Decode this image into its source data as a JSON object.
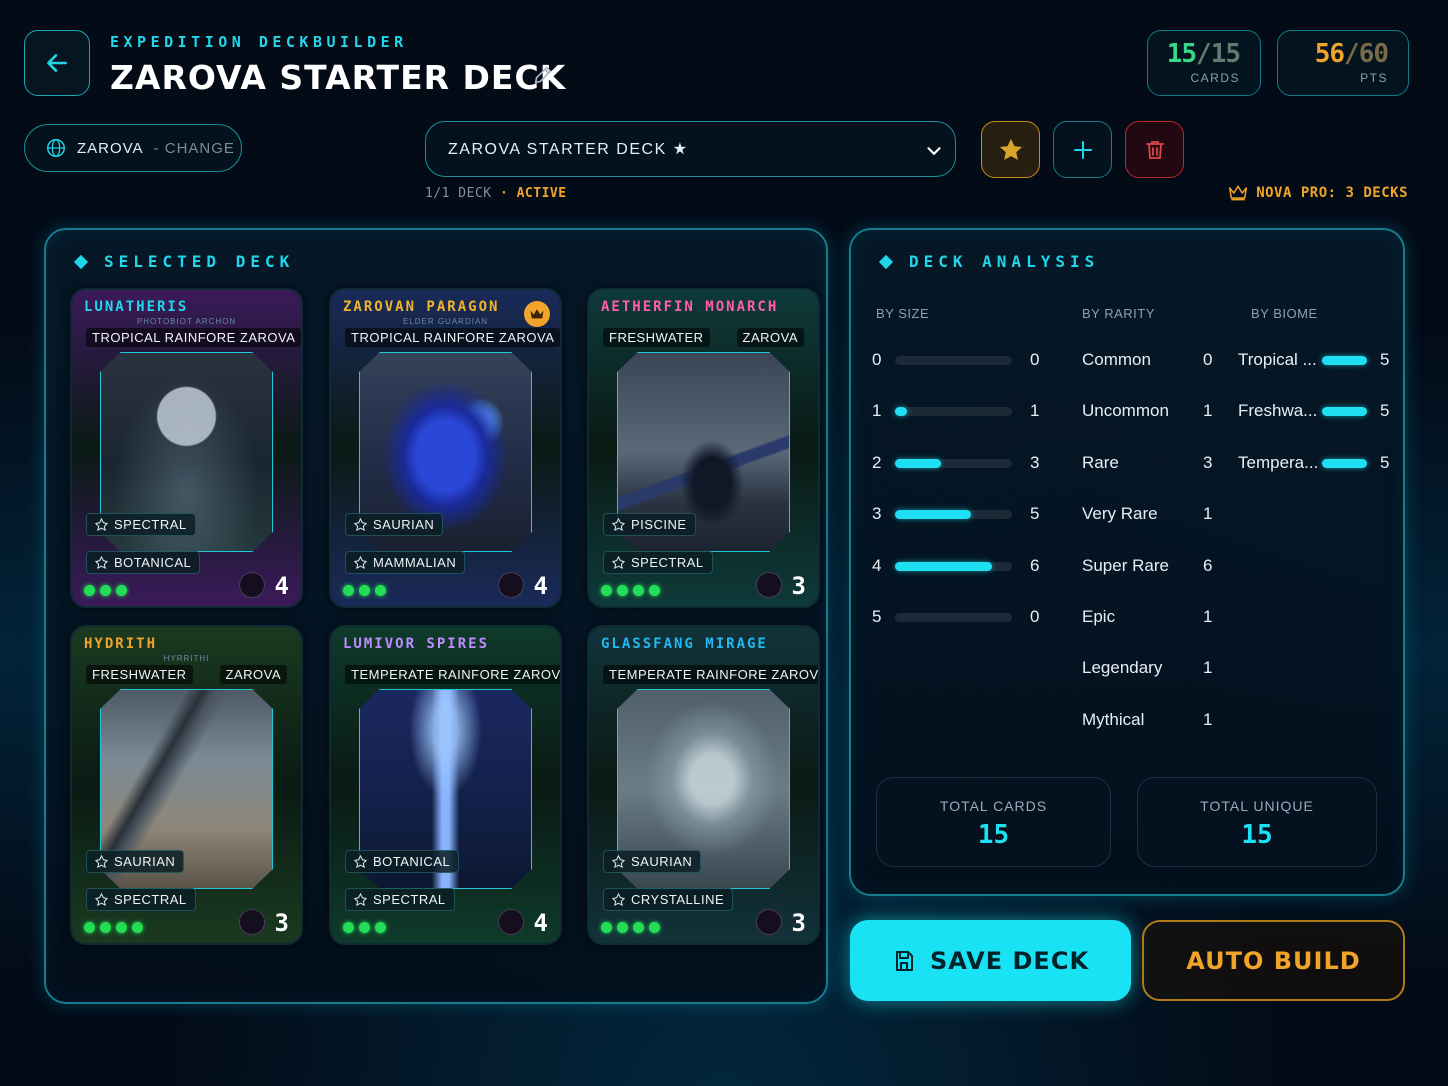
{
  "header": {
    "eyebrow": "EXPEDITION DECKBUILDER",
    "title": "ZAROVA STARTER DECK",
    "cards_stat": {
      "current": "15",
      "sep": "/",
      "max": "15",
      "label": "CARDS"
    },
    "points_stat": {
      "current": "56",
      "sep": "/",
      "max": "60",
      "label": "PTS"
    }
  },
  "realm": {
    "name": "ZAROVA",
    "action": "- CHANGE"
  },
  "deck_select": {
    "selected": "ZAROVA STARTER DECK ★"
  },
  "deck_meta": {
    "count": "1/1 DECK",
    "sep": "·",
    "status": "ACTIVE"
  },
  "pro_notice": "NOVA PRO: 3 DECKS",
  "selected_deck": {
    "heading": "SELECTED DECK",
    "cards": [
      {
        "name": "LUNATHERIS",
        "subtitle": "PHOTOBIOT ARCHON",
        "biome": "TROPICAL RAINFORE ZAROVA",
        "region": "",
        "tags": [
          "SPECTRAL",
          "BOTANICAL"
        ],
        "rarity_dots": 3,
        "cost": "4",
        "name_color": "#23d6ea",
        "art": "moon"
      },
      {
        "name": "ZAROVAN PARAGON",
        "subtitle": "ELDER GUARDIAN",
        "biome": "TROPICAL RAINFORE ZAROVA",
        "region": "",
        "tags": [
          "SAURIAN",
          "MAMMALIAN"
        ],
        "rarity_dots": 3,
        "cost": "4",
        "name_color": "#f0b429",
        "art": "beast",
        "crowned": true
      },
      {
        "name": "AETHERFIN MONARCH",
        "subtitle": "",
        "biome": "FRESHWATER",
        "region": "ZAROVA",
        "tags": [
          "PISCINE",
          "SPECTRAL"
        ],
        "rarity_dots": 4,
        "cost": "3",
        "name_color": "#ff5fa8",
        "art": "fin"
      },
      {
        "name": "HYDRITH",
        "subtitle": "HYRRITHI",
        "biome": "FRESHWATER",
        "region": "ZAROVA",
        "tags": [
          "SAURIAN",
          "SPECTRAL"
        ],
        "rarity_dots": 4,
        "cost": "3",
        "name_color": "#f0a52a",
        "art": "river"
      },
      {
        "name": "LUMIVOR SPIRES",
        "subtitle": "",
        "biome": "TEMPERATE RAINFORE ZAROVA",
        "region": "",
        "tags": [
          "BOTANICAL",
          "SPECTRAL"
        ],
        "rarity_dots": 3,
        "cost": "4",
        "name_color": "#c08cff",
        "art": "tree"
      },
      {
        "name": "GLASSFANG MIRAGE",
        "subtitle": "",
        "biome": "TEMPERATE RAINFORE ZAROVA",
        "region": "",
        "tags": [
          "SAURIAN",
          "CRYSTALLINE"
        ],
        "rarity_dots": 4,
        "cost": "3",
        "name_color": "#23b8f0",
        "art": "glass"
      }
    ]
  },
  "analysis": {
    "heading": "DECK ANALYSIS",
    "by_size_label": "BY SIZE",
    "by_rarity_label": "BY RARITY",
    "by_biome_label": "BY BIOME",
    "by_size": [
      {
        "size": "0",
        "count": "0",
        "fill": 0
      },
      {
        "size": "1",
        "count": "1",
        "fill": 0.1
      },
      {
        "size": "2",
        "count": "3",
        "fill": 0.39
      },
      {
        "size": "3",
        "count": "5",
        "fill": 0.65
      },
      {
        "size": "4",
        "count": "6",
        "fill": 0.83
      },
      {
        "size": "5",
        "count": "0",
        "fill": 0
      }
    ],
    "by_rarity": [
      {
        "name": "Common",
        "count": "0"
      },
      {
        "name": "Uncommon",
        "count": "1"
      },
      {
        "name": "Rare",
        "count": "3"
      },
      {
        "name": "Very Rare",
        "count": "1"
      },
      {
        "name": "Super Rare",
        "count": "6"
      },
      {
        "name": "Epic",
        "count": "1"
      },
      {
        "name": "Legendary",
        "count": "1"
      },
      {
        "name": "Mythical",
        "count": "1"
      }
    ],
    "by_biome": [
      {
        "name": "Tropical ...",
        "count": "5",
        "fill": 1
      },
      {
        "name": "Freshwa...",
        "count": "5",
        "fill": 1
      },
      {
        "name": "Tempera...",
        "count": "5",
        "fill": 1
      }
    ],
    "total_cards_label": "TOTAL CARDS",
    "total_cards": "15",
    "total_unique_label": "TOTAL UNIQUE",
    "total_unique": "15"
  },
  "actions": {
    "save": "SAVE DECK",
    "auto_build": "AUTO BUILD"
  },
  "colors": {
    "accent": "#1ee0f2",
    "gold": "#f0a52a",
    "danger": "#d03434",
    "success": "#22dd55"
  }
}
